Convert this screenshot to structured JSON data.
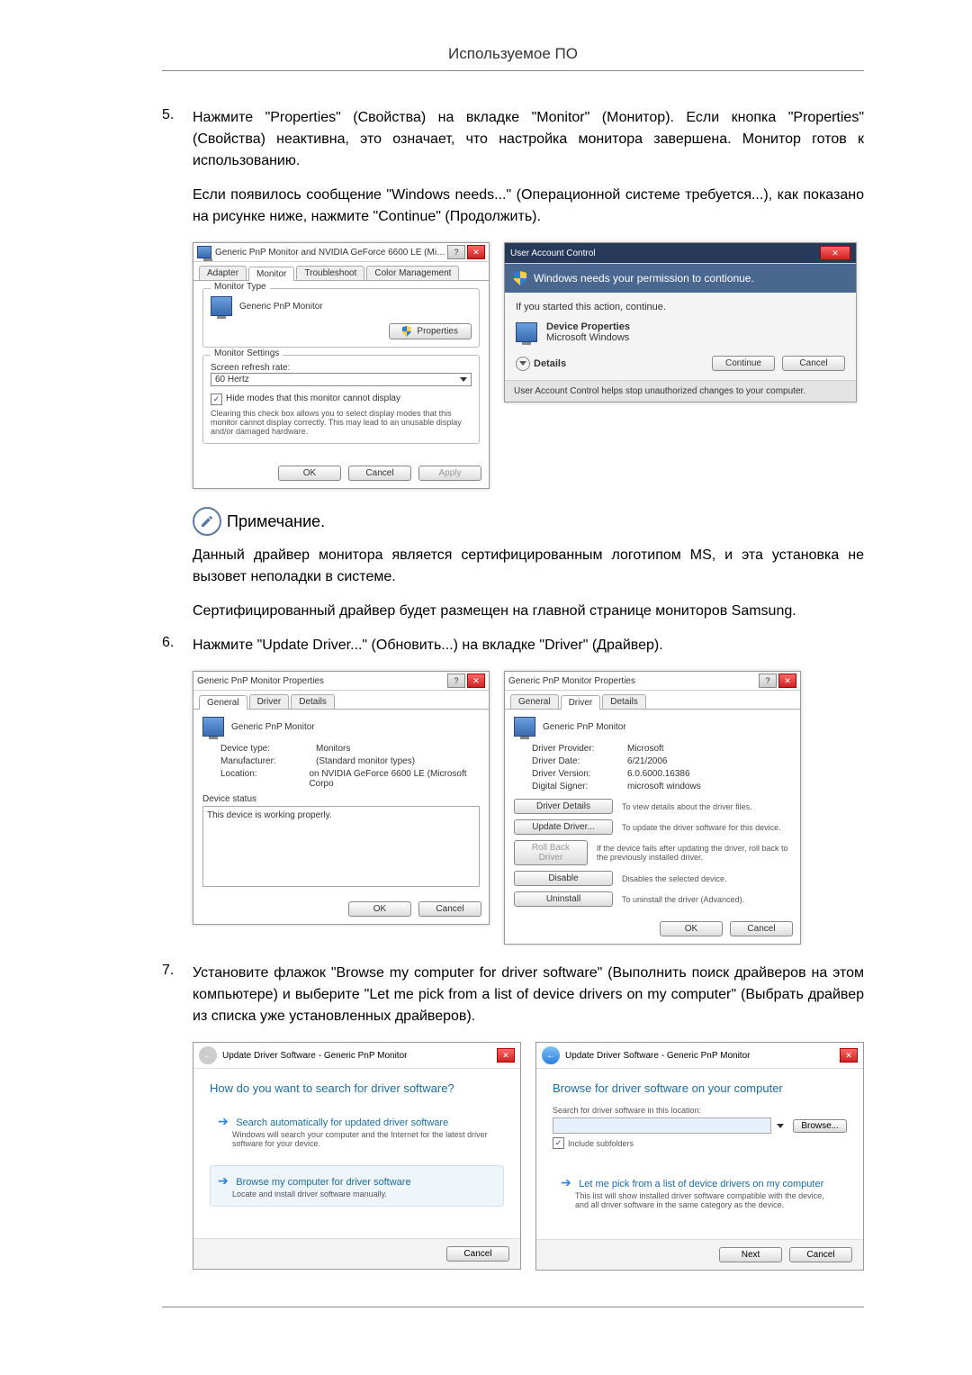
{
  "header": "Используемое ПО",
  "steps": {
    "s5_num": "5.",
    "s5_p1": "Нажмите \"Properties\" (Свойства) на вкладке \"Monitor\" (Монитор). Если кнопка \"Properties\" (Свойства) неактивна, это означает, что настройка монитора завершена. Монитор готов к использованию.",
    "s5_p2": "Если появилось сообщение \"Windows needs...\" (Операционной системе требуется...), как показано на рисунке ниже, нажмите \"Continue\" (Продолжить).",
    "s6_num": "6.",
    "s6_p1": "Нажмите \"Update Driver...\" (Обновить...) на вкладке \"Driver\" (Драйвер).",
    "s7_num": "7.",
    "s7_p1": "Установите флажок \"Browse my computer for driver software\" (Выполнить поиск драйверов на этом компьютере) и выберите \"Let me pick from a list of device drivers on my computer\" (Выбрать драйвер из списка уже установленных драйверов)."
  },
  "note": {
    "title": "Примечание.",
    "p1": "Данный драйвер монитора является сертифицированным логотипом MS, и эта установка не вызовет неполадки в системе.",
    "p2": "Сертифицированный драйвер будет размещен на главной странице мониторов Samsung."
  },
  "fig1a": {
    "title": "Generic PnP Monitor and NVIDIA GeForce 6600 LE (Microsoft Co...",
    "tabs": [
      "Adapter",
      "Monitor",
      "Troubleshoot",
      "Color Management"
    ],
    "monitor_type_label": "Monitor Type",
    "monitor_name": "Generic PnP Monitor",
    "properties_btn": "Properties",
    "monitor_settings_label": "Monitor Settings",
    "refresh_label": "Screen refresh rate:",
    "refresh_value": "60 Hertz",
    "hide_modes_label": "Hide modes that this monitor cannot display",
    "hide_modes_desc": "Clearing this check box allows you to select display modes that this monitor cannot display correctly. This may lead to an unusable display and/or damaged hardware.",
    "ok": "OK",
    "cancel": "Cancel",
    "apply": "Apply"
  },
  "fig1b": {
    "title": "User Account Control",
    "headline": "Windows needs your permission to contionue.",
    "sub": "If you started this action, continue.",
    "app_name": "Device Properties",
    "publisher": "Microsoft Windows",
    "details": "Details",
    "continue": "Continue",
    "cancel": "Cancel",
    "foot": "User Account Control helps stop unauthorized changes to your computer."
  },
  "fig2a": {
    "title": "Generic PnP Monitor Properties",
    "tabs": [
      "General",
      "Driver",
      "Details"
    ],
    "monitor_name": "Generic PnP Monitor",
    "device_type_k": "Device type:",
    "device_type_v": "Monitors",
    "manufacturer_k": "Manufacturer:",
    "manufacturer_v": "(Standard monitor types)",
    "location_k": "Location:",
    "location_v": "on NVIDIA GeForce 6600 LE (Microsoft Corpo",
    "device_status_k": "Device status",
    "device_status_v": "This device is working properly.",
    "ok": "OK",
    "cancel": "Cancel"
  },
  "fig2b": {
    "title": "Generic PnP Monitor Properties",
    "tabs": [
      "General",
      "Driver",
      "Details"
    ],
    "monitor_name": "Generic PnP Monitor",
    "provider_k": "Driver Provider:",
    "provider_v": "Microsoft",
    "date_k": "Driver Date:",
    "date_v": "6/21/2006",
    "version_k": "Driver Version:",
    "version_v": "6.0.6000.16386",
    "signer_k": "Digital Signer:",
    "signer_v": "microsoft windows",
    "btn_details": "Driver Details",
    "btn_details_desc": "To view details about the driver files.",
    "btn_update": "Update Driver...",
    "btn_update_desc": "To update the driver software for this device.",
    "btn_rollback": "Roll Back Driver",
    "btn_rollback_desc": "If the device fails after updating the driver, roll back to the previously installed driver.",
    "btn_disable": "Disable",
    "btn_disable_desc": "Disables the selected device.",
    "btn_uninstall": "Uninstall",
    "btn_uninstall_desc": "To uninstall the driver (Advanced).",
    "ok": "OK",
    "cancel": "Cancel"
  },
  "fig3a": {
    "title": "Update Driver Software - Generic PnP Monitor",
    "heading": "How do you want to search for driver software?",
    "opt1_title": "Search automatically for updated driver software",
    "opt1_desc": "Windows will search your computer and the Internet for the latest driver software for your device.",
    "opt2_title": "Browse my computer for driver software",
    "opt2_desc": "Locate and install driver software manually.",
    "cancel": "Cancel"
  },
  "fig3b": {
    "title": "Update Driver Software - Generic PnP Monitor",
    "heading": "Browse for driver software on your computer",
    "search_label": "Search for driver software in this location:",
    "browse": "Browse...",
    "include_sub": "Include subfolders",
    "opt_title": "Let me pick from a list of device drivers on my computer",
    "opt_desc": "This list will show installed driver software compatible with the device, and all driver software in the same category as the device.",
    "next": "Next",
    "cancel": "Cancel"
  }
}
